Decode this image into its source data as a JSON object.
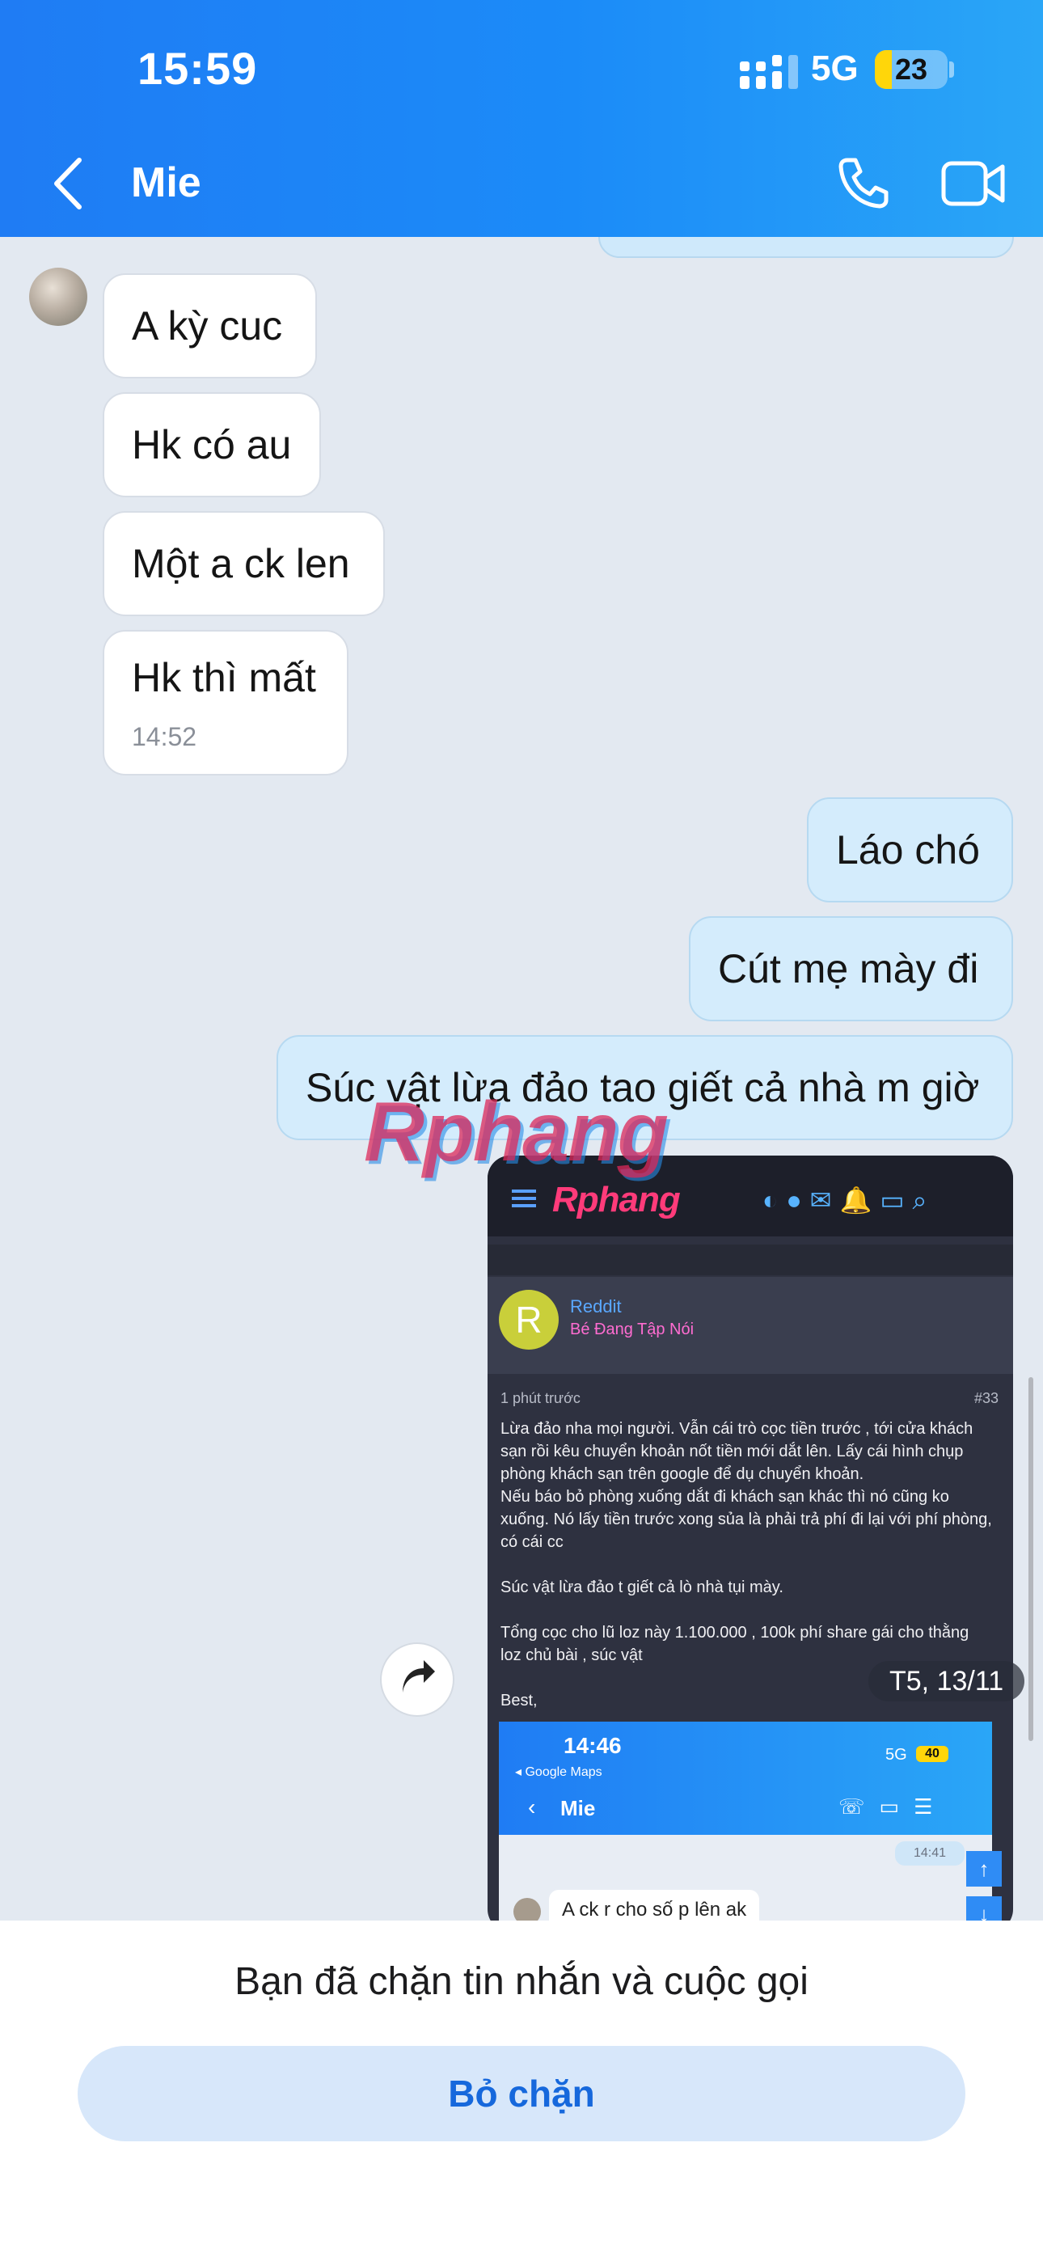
{
  "status_bar": {
    "time": "15:59",
    "network": "5G",
    "battery": "23",
    "battery_level": 0.23
  },
  "header": {
    "contact_name": "Mie"
  },
  "messages": {
    "incoming": [
      {
        "text": "A kỳ cuc"
      },
      {
        "text": "Hk có au"
      },
      {
        "text": "Một a ck len"
      },
      {
        "text": "Hk thì mất",
        "time": "14:52"
      }
    ],
    "outgoing": [
      {
        "text": "Láo chó"
      },
      {
        "text": "Cút mẹ mày đi"
      },
      {
        "text": "Súc vật lừa đảo tao giết cả nhà m giờ"
      }
    ]
  },
  "watermark": "Rphang",
  "date_pill": "T5, 13/11",
  "forwarded_image": {
    "logo": "Rphang",
    "avatar_letter": "R",
    "user_name": "Reddit",
    "user_role": "Bé Đang Tập Nói",
    "posted": "1 phút trước",
    "post_number": "#33",
    "body": "Lừa đảo nha mọi người. Vẫn cái trò cọc tiền trước , tới cửa khách sạn rồi kêu chuyển khoản nốt tiền mới dắt lên. Lấy cái hình chụp phòng khách sạn trên google để dụ chuyển khoản.\nNếu báo bỏ phòng xuống dắt đi khách sạn khác thì nó cũng ko xuống. Nó lấy tiền trước xong sủa là phải trả phí đi lại với phí phòng, có cái cc\n\nSúc vật lừa đảo t giết cả lò nhà tụi mày.\n\nTổng cọc cho lũ loz này 1.100.000 , 100k phí share gái cho thằng loz chủ bài , súc vật\n\nBest,",
    "inner": {
      "time": "14:46",
      "app_back": "◂ Google Maps",
      "network": "5G",
      "battery": "40",
      "contact": "Mie",
      "timestamp": "14:41",
      "message": "A ck r cho số p lên ak"
    }
  },
  "footer": {
    "blocked_text": "Bạn đã chặn tin nhắn và cuộc gọi",
    "unblock_label": "Bỏ chặn"
  },
  "colors": {
    "header": "#1f7cf4",
    "outgoing_bubble": "#d4ecfc",
    "accent": "#1668dc"
  }
}
